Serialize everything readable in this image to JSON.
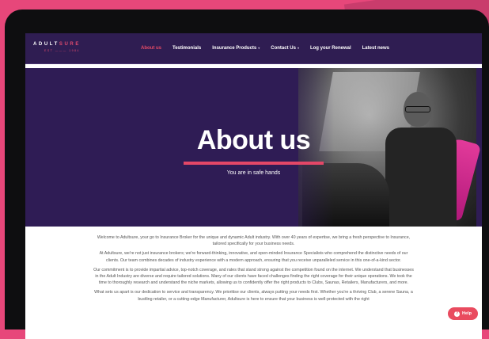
{
  "header": {
    "logo": {
      "text_main": "ADULT",
      "text_accent": "SURE",
      "tagline": "EST ——— 1984"
    },
    "nav": [
      {
        "label": "About us",
        "active": true,
        "dropdown": false
      },
      {
        "label": "Testimonials",
        "active": false,
        "dropdown": false
      },
      {
        "label": "Insurance Products",
        "active": false,
        "dropdown": true
      },
      {
        "label": "Contact Us",
        "active": false,
        "dropdown": true
      },
      {
        "label": "Log your Renewal",
        "active": false,
        "dropdown": false
      },
      {
        "label": "Latest news",
        "active": false,
        "dropdown": false
      }
    ],
    "caret": "▾"
  },
  "hero": {
    "title": "About us",
    "subtitle": "You are in safe hands"
  },
  "content": {
    "paragraphs": [
      "Welcome to Adultsure, your go to Insurance Broker for the unique and dynamic Adult industry. With over 40 years of expertise, we bring a fresh perspective to Insurance, tailored specifically for your business needs.",
      "At Adultsure, we're not just insurance brokers; we're forward-thinking, innovative, and open-minded Insurance Specialists who comprehend the distinctive needs of our clients. Our team combines decades of industry experience with a modern approach, ensuring that you receive unparalleled service in this one-of-a-kind sector.",
      "Our commitment is to provide impartial advice, top-notch coverage, and rates that stand strong against the competition found on the internet. We understand that businesses in the Adult Industry are diverse and require tailored solutions. Many of our clients have faced challenges finding the right coverage for their unique operations. We took the time to thoroughly research and understand the niche markets, allowing us to confidently offer the right products to Clubs, Saunas, Retailers, Manufacturers, and more.",
      "What sets us apart is our dedication to service and transparency. We prioritise our clients, always putting your needs first. Whether you're a thriving Club, a serene Sauna, a bustling retailer, or a cutting-edge Manufacturer, Adultsure is here to ensure that your business is well-protected with the right"
    ]
  },
  "help": {
    "label": "Help",
    "icon": "?"
  },
  "colors": {
    "accent": "#e44767",
    "header_bg": "#2f1d52",
    "hero_bg": "#2f1c55",
    "page_bg": "#e7477a"
  }
}
